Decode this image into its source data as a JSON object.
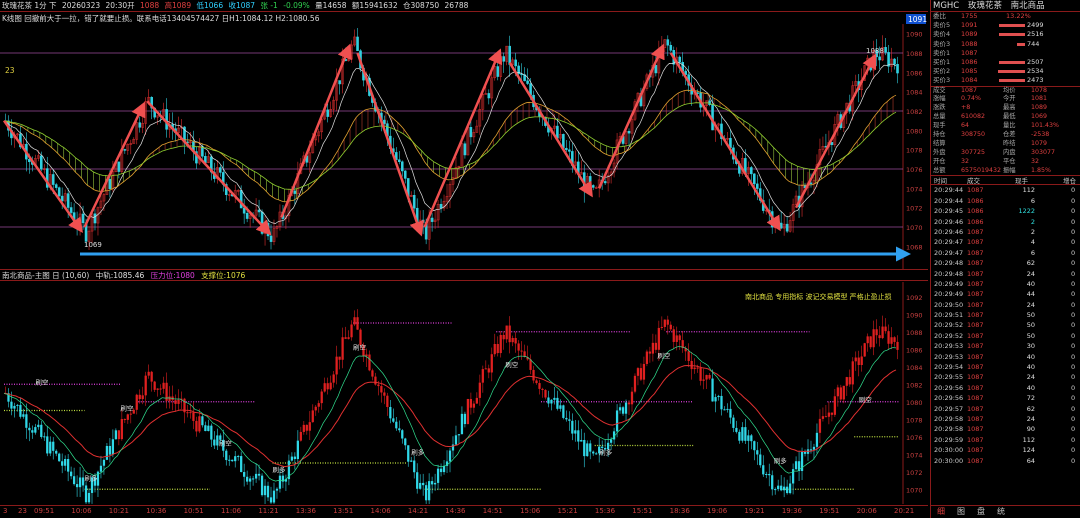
{
  "header": {
    "symbol_period": "玫瑰花茶 1分 下",
    "date": "20260323",
    "time": "20:30开",
    "open": "1088",
    "high": "高1089",
    "low": "低1066",
    "close": "收1087",
    "change": "张 -1",
    "change_pct": "-0.09%",
    "volume": "量14658",
    "amount": "额15941632",
    "oi": "仓308750",
    "extra": "26788"
  },
  "chart1": {
    "info_line": "K线图 回撤前大于一拉，错了就要止损。联系电话13404574427 日H1:1084.12 H2:1080.56",
    "left_label": "23",
    "price_axis": [
      "1090",
      "1088",
      "1086",
      "1084",
      "1082",
      "1080",
      "1078",
      "1076",
      "1074",
      "1072",
      "1070",
      "1068"
    ],
    "current_price": "1091",
    "low_label": "1069",
    "high_label": "1088"
  },
  "chart2": {
    "title": "南北商品-主图 日 (10,60)",
    "mid": "中轨:1085.46",
    "pressure": "压力位:1080",
    "support": "支撑位:1076",
    "banner": "南北商品  专用指标  波记交易模型  严格止盈止损",
    "price_axis": [
      "1092",
      "1090",
      "1088",
      "1086",
      "1084",
      "1082",
      "1080",
      "1078",
      "1076",
      "1074",
      "1072",
      "1070"
    ],
    "signal_labels": [
      "刷多",
      "刷空"
    ]
  },
  "xaxis": {
    "left_labels": [
      "3",
      "23"
    ],
    "times": [
      "09:51",
      "10:06",
      "10:21",
      "10:36",
      "10:51",
      "11:06",
      "11:21",
      "13:36",
      "13:51",
      "14:06",
      "14:21",
      "14:36",
      "14:51",
      "15:06",
      "15:21",
      "15:36",
      "15:51",
      "18:36",
      "19:06",
      "19:21",
      "19:36",
      "19:51",
      "20:06",
      "20:21"
    ]
  },
  "right": {
    "header": {
      "code": "MGHC",
      "name": "玫瑰花茶",
      "group": "南北商品"
    },
    "weibi": {
      "label": "委比",
      "value": "13.22%"
    },
    "asks": [
      {
        "l": "卖价5",
        "p": "1091",
        "q": "2499"
      },
      {
        "l": "卖价4",
        "p": "1089",
        "q": "2516"
      },
      {
        "l": "卖价3",
        "p": "1088",
        "q": "744"
      },
      {
        "l": "卖价1",
        "p": "1087",
        "q": ""
      }
    ],
    "bids": [
      {
        "l": "买价1",
        "p": "1086",
        "q": "2507"
      },
      {
        "l": "买价2",
        "p": "1085",
        "q": "2534"
      },
      {
        "l": "买价3",
        "p": "1084",
        "q": "2473"
      }
    ],
    "stats": [
      {
        "k1": "成交",
        "v1": "1087",
        "k2": "均价",
        "v2": "1078"
      },
      {
        "k1": "涨幅",
        "v1": "0.74%",
        "k2": "今开",
        "v2": "1081"
      },
      {
        "k1": "涨跌",
        "v1": "+8",
        "k2": "最高",
        "v2": "1089"
      },
      {
        "k1": "总量",
        "v1": "610082",
        "k2": "最低",
        "v2": "1069"
      },
      {
        "k1": "现手",
        "v1": "64",
        "k2": "量比",
        "v2": "101.43%"
      },
      {
        "k1": "持仓",
        "v1": "308750",
        "k2": "仓差",
        "v2": "-2538"
      },
      {
        "k1": "结算",
        "v1": "",
        "k2": "昨结",
        "v2": "1079"
      },
      {
        "k1": "外盘",
        "v1": "307725",
        "k2": "内盘",
        "v2": "303077"
      },
      {
        "k1": "开仓",
        "v1": "32",
        "k2": "平仓",
        "v2": "32"
      },
      {
        "k1": "总额",
        "v1": "6575019432",
        "k2": "振幅",
        "v2": "1.85%"
      }
    ],
    "ticks_header": {
      "time": "时间",
      "price": "成交",
      "vol": "现手",
      "oi": "增仓"
    },
    "ticks": [
      {
        "t": "20:29:44",
        "p": "1087",
        "v": "112",
        "o": "0",
        "up": false
      },
      {
        "t": "20:29:44",
        "p": "1086",
        "v": "6",
        "o": "0",
        "up": false
      },
      {
        "t": "20:29:45",
        "p": "1086",
        "v": "1222",
        "o": "0",
        "up": true
      },
      {
        "t": "20:29:46",
        "p": "1086",
        "v": "2",
        "o": "0",
        "up": true
      },
      {
        "t": "20:29:46",
        "p": "1087",
        "v": "2",
        "o": "0",
        "up": false
      },
      {
        "t": "20:29:47",
        "p": "1087",
        "v": "4",
        "o": "0",
        "up": false
      },
      {
        "t": "20:29:47",
        "p": "1087",
        "v": "6",
        "o": "0",
        "up": false
      },
      {
        "t": "20:29:48",
        "p": "1087",
        "v": "62",
        "o": "0",
        "up": false
      },
      {
        "t": "20:29:48",
        "p": "1087",
        "v": "24",
        "o": "0",
        "up": false
      },
      {
        "t": "20:29:49",
        "p": "1087",
        "v": "40",
        "o": "0",
        "up": false
      },
      {
        "t": "20:29:49",
        "p": "1087",
        "v": "44",
        "o": "0",
        "up": false
      },
      {
        "t": "20:29:50",
        "p": "1087",
        "v": "24",
        "o": "0",
        "up": false
      },
      {
        "t": "20:29:51",
        "p": "1087",
        "v": "50",
        "o": "0",
        "up": false
      },
      {
        "t": "20:29:52",
        "p": "1087",
        "v": "50",
        "o": "0",
        "up": false
      },
      {
        "t": "20:29:52",
        "p": "1087",
        "v": "50",
        "o": "0",
        "up": false
      },
      {
        "t": "20:29:53",
        "p": "1087",
        "v": "30",
        "o": "0",
        "up": false
      },
      {
        "t": "20:29:53",
        "p": "1087",
        "v": "40",
        "o": "0",
        "up": false
      },
      {
        "t": "20:29:54",
        "p": "1087",
        "v": "40",
        "o": "0",
        "up": false
      },
      {
        "t": "20:29:55",
        "p": "1087",
        "v": "24",
        "o": "0",
        "up": false
      },
      {
        "t": "20:29:56",
        "p": "1087",
        "v": "40",
        "o": "0",
        "up": false
      },
      {
        "t": "20:29:56",
        "p": "1087",
        "v": "72",
        "o": "0",
        "up": false
      },
      {
        "t": "20:29:57",
        "p": "1087",
        "v": "62",
        "o": "0",
        "up": false
      },
      {
        "t": "20:29:58",
        "p": "1087",
        "v": "24",
        "o": "0",
        "up": false
      },
      {
        "t": "20:29:58",
        "p": "1087",
        "v": "90",
        "o": "0",
        "up": false
      },
      {
        "t": "20:29:59",
        "p": "1087",
        "v": "112",
        "o": "0",
        "up": false
      },
      {
        "t": "20:30:00",
        "p": "1087",
        "v": "124",
        "o": "0",
        "up": false
      },
      {
        "t": "20:30:00",
        "p": "1087",
        "v": "64",
        "o": "0",
        "up": false
      }
    ],
    "tabs": [
      "细",
      "图",
      "盘",
      "统"
    ]
  }
}
